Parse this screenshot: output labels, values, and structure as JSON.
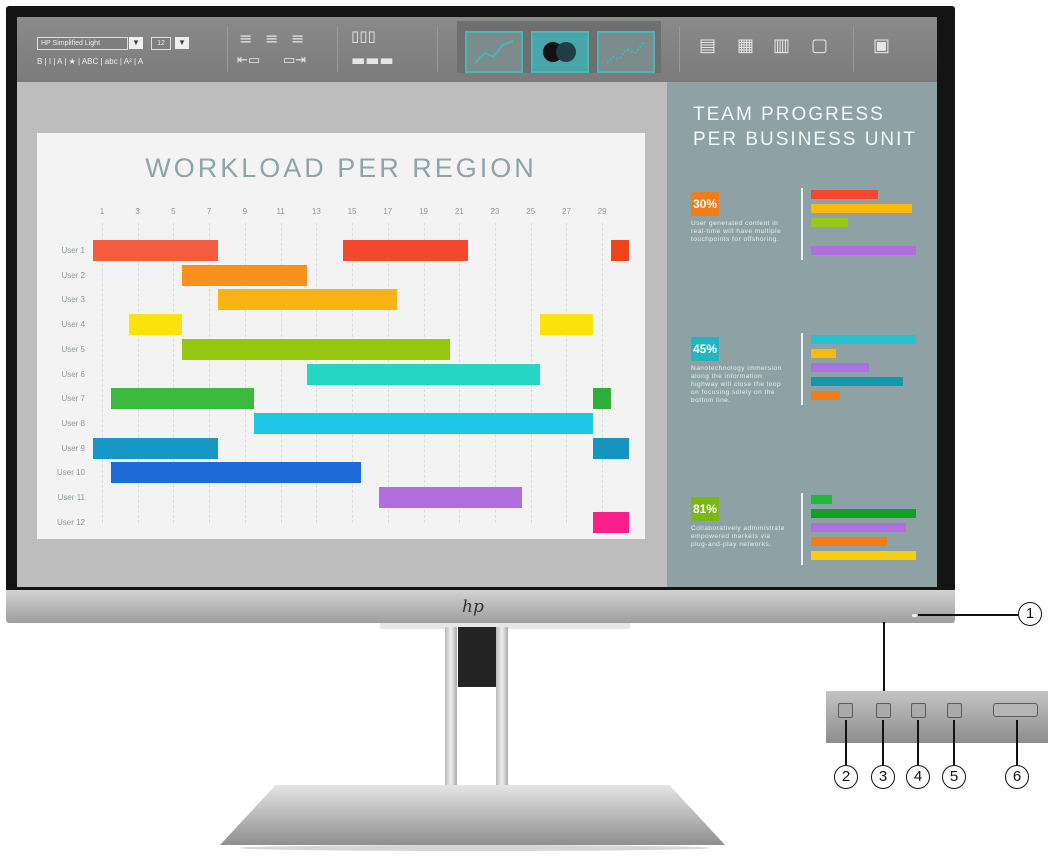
{
  "toolbar": {
    "font_name": "HP Simplified Light",
    "font_size": "12",
    "format_row": "B | I | A | ★ | ABC | abc | A² | A"
  },
  "slide": {
    "title": "WORKLOAD PER REGION",
    "x_ticks": [
      "1",
      "3",
      "5",
      "7",
      "9",
      "11",
      "13",
      "15",
      "17",
      "19",
      "21",
      "23",
      "25",
      "27",
      "29"
    ],
    "users": [
      "User 1",
      "User 2",
      "User 3",
      "User 4",
      "User 5",
      "User 6",
      "User 7",
      "User 8",
      "User 9",
      "User 10",
      "User 11",
      "User 12"
    ]
  },
  "chart_data": [
    {
      "type": "bar",
      "title": "WORKLOAD PER REGION",
      "xlim": [
        0,
        30
      ],
      "x_ticks": [
        1,
        3,
        5,
        7,
        9,
        11,
        13,
        15,
        17,
        19,
        21,
        23,
        25,
        27,
        29
      ],
      "tasks": [
        {
          "row": 0,
          "start": 0,
          "end": 7,
          "color": "#f45b3f"
        },
        {
          "row": 0,
          "start": 14,
          "end": 21,
          "color": "#f2492e"
        },
        {
          "row": 0,
          "start": 29,
          "end": 30,
          "color": "#f0441b"
        },
        {
          "row": 1,
          "start": 5,
          "end": 12,
          "color": "#f7901c"
        },
        {
          "row": 2,
          "start": 7,
          "end": 17,
          "color": "#f9b313"
        },
        {
          "row": 3,
          "start": 2,
          "end": 5,
          "color": "#fde20e"
        },
        {
          "row": 3,
          "start": 25,
          "end": 28,
          "color": "#fde20e"
        },
        {
          "row": 4,
          "start": 5,
          "end": 20,
          "color": "#95c610"
        },
        {
          "row": 5,
          "start": 12,
          "end": 25,
          "color": "#26d6c4"
        },
        {
          "row": 6,
          "start": 1,
          "end": 9,
          "color": "#3cba3f"
        },
        {
          "row": 6,
          "start": 28,
          "end": 29,
          "color": "#31ad3a"
        },
        {
          "row": 7,
          "start": 9,
          "end": 28,
          "color": "#1fc7e6"
        },
        {
          "row": 8,
          "start": 0,
          "end": 7,
          "color": "#1797c4"
        },
        {
          "row": 8,
          "start": 28,
          "end": 30,
          "color": "#1594c0"
        },
        {
          "row": 9,
          "start": 1,
          "end": 15,
          "color": "#1d6ad8"
        },
        {
          "row": 10,
          "start": 16,
          "end": 24,
          "color": "#b06ee0"
        },
        {
          "row": 11,
          "start": 28,
          "end": 30,
          "color": "#f81f8a"
        }
      ]
    },
    {
      "type": "bar",
      "title": "TEAM PROGRESS PER BUSINESS UNIT",
      "groups": [
        {
          "pct": "30%",
          "pct_color": "#f07d1a",
          "desc": "User generated content in real-time will have multiple touchpoints for offshoring.",
          "bars": [
            {
              "value": 0.64,
              "color": "#f2492e"
            },
            {
              "value": 0.96,
              "color": "#f9b90f"
            },
            {
              "value": 0.35,
              "color": "#98c913"
            },
            {
              "value": 0,
              "color": "#8ea2a6"
            },
            {
              "value": 1.0,
              "color": "#b06ee0"
            }
          ]
        },
        {
          "pct": "45%",
          "pct_color": "#26b5bf",
          "desc": "Nanotechnology immersion along the information highway will close the loop on focusing solely on the bottom line.",
          "bars": [
            {
              "value": 1.0,
              "color": "#26c2ce"
            },
            {
              "value": 0.24,
              "color": "#f9b90f"
            },
            {
              "value": 0.55,
              "color": "#b06ee0"
            },
            {
              "value": 0.88,
              "color": "#1797a9"
            },
            {
              "value": 0.28,
              "color": "#f07d1a"
            }
          ]
        },
        {
          "pct": "81%",
          "pct_color": "#7cb71a",
          "desc": "Collaboratively administrate empowered markets via plug-and-play networks.",
          "bars": [
            {
              "value": 0.2,
              "color": "#1fb93a"
            },
            {
              "value": 1.0,
              "color": "#12a02c"
            },
            {
              "value": 0.9,
              "color": "#b06ee0"
            },
            {
              "value": 0.72,
              "color": "#f07d1a"
            },
            {
              "value": 1.0,
              "color": "#f9cd12"
            }
          ]
        }
      ]
    }
  ],
  "panel": {
    "title_line1": "TEAM PROGRESS",
    "title_line2": "PER BUSINESS UNIT"
  },
  "monitor": {
    "logo": "hp"
  },
  "callouts": [
    "1",
    "2",
    "3",
    "4",
    "5",
    "6"
  ]
}
